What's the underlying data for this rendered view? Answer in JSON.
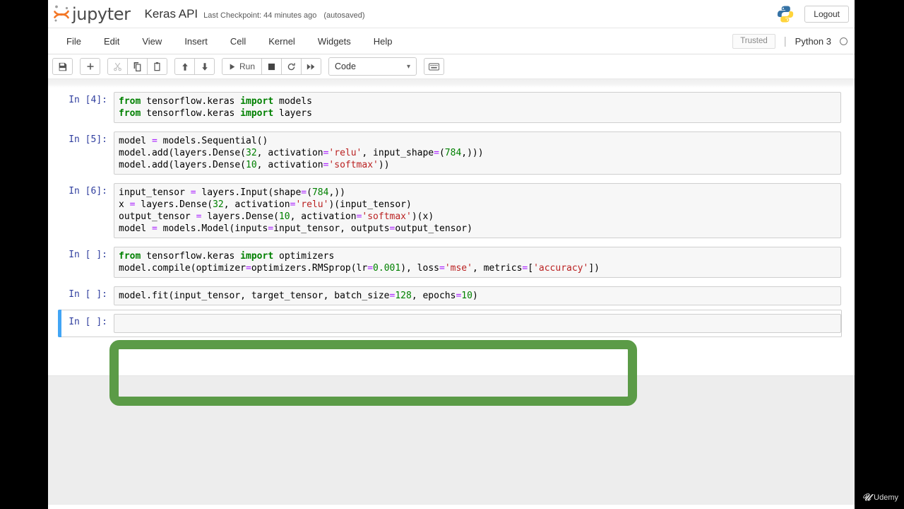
{
  "header": {
    "logo_text": "jupyter",
    "logo_icon": "jupyter-logo",
    "notebook_title": "Keras API",
    "checkpoint": "Last Checkpoint: 44 minutes ago",
    "autosaved": "(autosaved)",
    "python_logo_icon": "python-logo",
    "logout_label": "Logout"
  },
  "menubar": {
    "items": [
      {
        "label": "File"
      },
      {
        "label": "Edit"
      },
      {
        "label": "View"
      },
      {
        "label": "Insert"
      },
      {
        "label": "Cell"
      },
      {
        "label": "Kernel"
      },
      {
        "label": "Widgets"
      },
      {
        "label": "Help"
      }
    ],
    "trusted_label": "Trusted",
    "kernel_name": "Python 3",
    "kernel_status_icon": "kernel-idle-circle"
  },
  "toolbar": {
    "save_icon": "save-floppy-icon",
    "add_icon": "plus-icon",
    "cut_icon": "scissors-icon",
    "copy_icon": "copy-icon",
    "paste_icon": "paste-icon",
    "move_up_icon": "arrow-up-icon",
    "move_down_icon": "arrow-down-icon",
    "run_label": "Run",
    "run_icon": "play-icon",
    "stop_icon": "stop-square-icon",
    "restart_icon": "restart-circle-icon",
    "restart_run_all_icon": "fast-forward-icon",
    "cell_type_value": "Code",
    "cell_type_chevron": "chevron-down-icon",
    "command_palette_icon": "keyboard-icon"
  },
  "notebook": {
    "cells": [
      {
        "prompt": "In [4]:",
        "selected": false,
        "lines": [
          [
            {
              "t": "from",
              "c": "k"
            },
            {
              "t": " tensorflow.keras ",
              "c": "b"
            },
            {
              "t": "import",
              "c": "k"
            },
            {
              "t": " models",
              "c": "b"
            }
          ],
          [
            {
              "t": "from",
              "c": "k"
            },
            {
              "t": " tensorflow.keras ",
              "c": "b"
            },
            {
              "t": "import",
              "c": "k"
            },
            {
              "t": " layers",
              "c": "b"
            }
          ]
        ]
      },
      {
        "prompt": "In [5]:",
        "selected": false,
        "lines": [
          [
            {
              "t": "model ",
              "c": "b"
            },
            {
              "t": "=",
              "c": "o"
            },
            {
              "t": " models.Sequential()",
              "c": "b"
            }
          ],
          [
            {
              "t": "model.add(layers.Dense(",
              "c": "b"
            },
            {
              "t": "32",
              "c": "n"
            },
            {
              "t": ", activation",
              "c": "b"
            },
            {
              "t": "=",
              "c": "o"
            },
            {
              "t": "'relu'",
              "c": "s"
            },
            {
              "t": ", input_shape",
              "c": "b"
            },
            {
              "t": "=",
              "c": "o"
            },
            {
              "t": "(",
              "c": "b"
            },
            {
              "t": "784",
              "c": "n"
            },
            {
              "t": ",)))",
              "c": "b"
            }
          ],
          [
            {
              "t": "model.add(layers.Dense(",
              "c": "b"
            },
            {
              "t": "10",
              "c": "n"
            },
            {
              "t": ", activation",
              "c": "b"
            },
            {
              "t": "=",
              "c": "o"
            },
            {
              "t": "'softmax'",
              "c": "s"
            },
            {
              "t": "))",
              "c": "b"
            }
          ]
        ]
      },
      {
        "prompt": "In [6]:",
        "selected": false,
        "lines": [
          [
            {
              "t": "input_tensor ",
              "c": "b"
            },
            {
              "t": "=",
              "c": "o"
            },
            {
              "t": " layers.Input(shape",
              "c": "b"
            },
            {
              "t": "=",
              "c": "o"
            },
            {
              "t": "(",
              "c": "b"
            },
            {
              "t": "784",
              "c": "n"
            },
            {
              "t": ",))",
              "c": "b"
            }
          ],
          [
            {
              "t": "x ",
              "c": "b"
            },
            {
              "t": "=",
              "c": "o"
            },
            {
              "t": " layers.Dense(",
              "c": "b"
            },
            {
              "t": "32",
              "c": "n"
            },
            {
              "t": ", activation",
              "c": "b"
            },
            {
              "t": "=",
              "c": "o"
            },
            {
              "t": "'relu'",
              "c": "s"
            },
            {
              "t": ")(input_tensor)",
              "c": "b"
            }
          ],
          [
            {
              "t": "output_tensor ",
              "c": "b"
            },
            {
              "t": "=",
              "c": "o"
            },
            {
              "t": " layers.Dense(",
              "c": "b"
            },
            {
              "t": "10",
              "c": "n"
            },
            {
              "t": ", activation",
              "c": "b"
            },
            {
              "t": "=",
              "c": "o"
            },
            {
              "t": "'softmax'",
              "c": "s"
            },
            {
              "t": ")(x)",
              "c": "b"
            }
          ],
          [
            {
              "t": "model ",
              "c": "b"
            },
            {
              "t": "=",
              "c": "o"
            },
            {
              "t": " models.Model(inputs",
              "c": "b"
            },
            {
              "t": "=",
              "c": "o"
            },
            {
              "t": "input_tensor, outputs",
              "c": "b"
            },
            {
              "t": "=",
              "c": "o"
            },
            {
              "t": "output_tensor)",
              "c": "b"
            }
          ]
        ]
      },
      {
        "prompt": "In [ ]:",
        "selected": false,
        "lines": [
          [
            {
              "t": "from",
              "c": "k"
            },
            {
              "t": " tensorflow.keras ",
              "c": "b"
            },
            {
              "t": "import",
              "c": "k"
            },
            {
              "t": " optimizers",
              "c": "b"
            }
          ],
          [
            {
              "t": "model.compile(optimizer",
              "c": "b"
            },
            {
              "t": "=",
              "c": "o"
            },
            {
              "t": "optimizers.RMSprop(lr",
              "c": "b"
            },
            {
              "t": "=",
              "c": "o"
            },
            {
              "t": "0.001",
              "c": "n"
            },
            {
              "t": "), loss",
              "c": "b"
            },
            {
              "t": "=",
              "c": "o"
            },
            {
              "t": "'mse'",
              "c": "s"
            },
            {
              "t": ", metrics",
              "c": "b"
            },
            {
              "t": "=",
              "c": "o"
            },
            {
              "t": "[",
              "c": "b"
            },
            {
              "t": "'accuracy'",
              "c": "s"
            },
            {
              "t": "])",
              "c": "b"
            }
          ]
        ]
      },
      {
        "prompt": "In [ ]:",
        "selected": false,
        "lines": [
          [
            {
              "t": "model.fit(input_tensor, target_tensor, batch_size",
              "c": "b"
            },
            {
              "t": "=",
              "c": "o"
            },
            {
              "t": "128",
              "c": "n"
            },
            {
              "t": ", epochs",
              "c": "b"
            },
            {
              "t": "=",
              "c": "o"
            },
            {
              "t": "10",
              "c": "n"
            },
            {
              "t": ")",
              "c": "b"
            }
          ]
        ]
      },
      {
        "prompt": "In [ ]:",
        "selected": true,
        "lines": [
          []
        ]
      }
    ]
  },
  "annotation": {
    "highlight_color": "#5b9b47",
    "shape": "rounded-rectangle-outline",
    "targets_cell_index": 3
  },
  "watermark": {
    "brand": "Udemy",
    "mark_icon": "udemy-logo"
  }
}
